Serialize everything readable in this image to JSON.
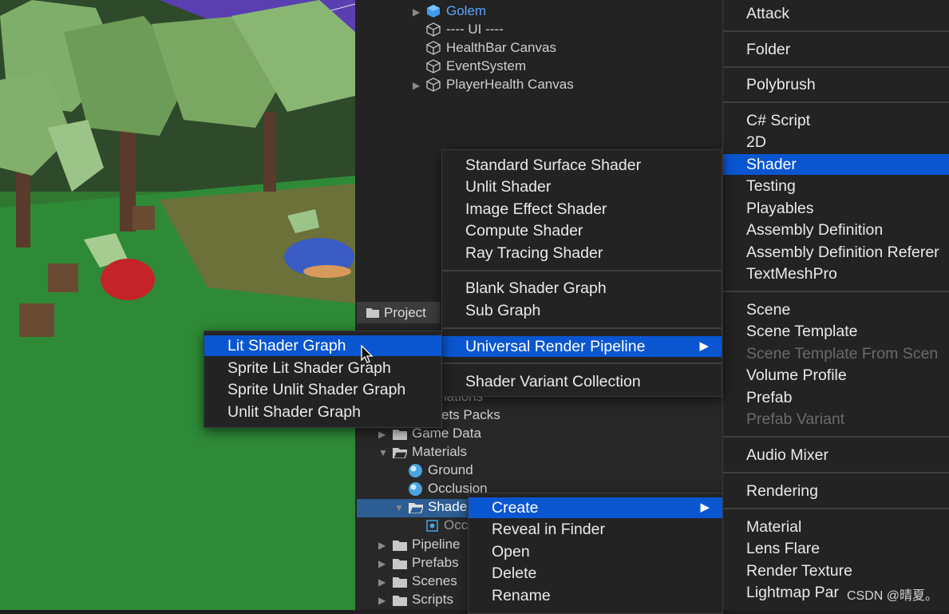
{
  "hierarchy": {
    "items": [
      {
        "label": "Golem",
        "expandable": true,
        "highlight": true
      },
      {
        "label": "---- UI ----",
        "expandable": false
      },
      {
        "label": "HealthBar Canvas",
        "expandable": false
      },
      {
        "label": "EventSystem",
        "expandable": false
      },
      {
        "label": "PlayerHealth Canvas",
        "expandable": true
      }
    ]
  },
  "project": {
    "tab_label": "Project",
    "tree": [
      {
        "label": "lations"
      },
      {
        "label": "ets Packs"
      },
      {
        "label": "Game Data"
      },
      {
        "label": "Materials"
      },
      {
        "label": "Ground"
      },
      {
        "label": "Occlusion"
      },
      {
        "label": "Shade"
      },
      {
        "label": "Occ"
      },
      {
        "label": "Pipeline"
      },
      {
        "label": "Prefabs"
      },
      {
        "label": "Scenes"
      },
      {
        "label": "Scripts"
      }
    ]
  },
  "context_menu": {
    "items": [
      "Create",
      "Reveal in Finder",
      "Open",
      "Delete",
      "Rename"
    ]
  },
  "create_menu": {
    "items": [
      "Attack",
      "Folder",
      "Polybrush",
      "C# Script",
      "2D",
      "Shader",
      "Testing",
      "Playables",
      "Assembly Definition",
      "Assembly Definition Referer",
      "TextMeshPro",
      "Scene",
      "Scene Template",
      "Scene Template From Scen",
      "Volume Profile",
      "Prefab",
      "Prefab Variant",
      "Audio Mixer",
      "Rendering",
      "Material",
      "Lens Flare",
      "Render Texture",
      "Lightmap Par"
    ]
  },
  "shader_menu": {
    "items": [
      "Standard Surface Shader",
      "Unlit Shader",
      "Image Effect Shader",
      "Compute Shader",
      "Ray Tracing Shader",
      "Blank Shader Graph",
      "Sub Graph",
      "Universal Render Pipeline",
      "Shader Variant Collection"
    ]
  },
  "urp_menu": {
    "items": [
      "Lit Shader Graph",
      "Sprite Lit Shader Graph",
      "Sprite Unlit Shader Graph",
      "Unlit Shader Graph"
    ]
  },
  "watermark": "CSDN @晴夏。",
  "colors": {
    "selection": "#0a56d1",
    "menu_bg": "#232323",
    "disabled": "#6a6a6a"
  }
}
